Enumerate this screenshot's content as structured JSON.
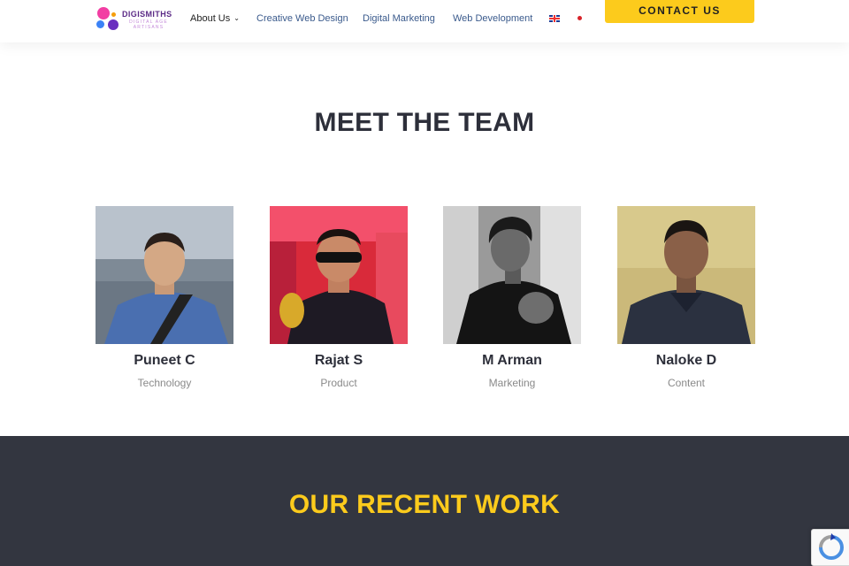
{
  "brand": {
    "name": "DIGISMITHS",
    "tagline": "DIGITAL AGE ARTISANS",
    "colors": {
      "pink": "#f23ea3",
      "purple": "#6a2fbf",
      "blue": "#3b82f6",
      "orange": "#f59e0b"
    }
  },
  "nav": {
    "items": [
      {
        "label": "About Us",
        "has_dropdown": true
      },
      {
        "label": "Creative Web Design"
      },
      {
        "label": "Digital Marketing"
      },
      {
        "label": "Web Development"
      }
    ],
    "languages": [
      "english-flag-icon",
      "japanese-flag-icon"
    ],
    "cta": "CONTACT US"
  },
  "team": {
    "title": "MEET THE TEAM",
    "members": [
      {
        "name": "Puneet C",
        "role": "Technology"
      },
      {
        "name": "Rajat S",
        "role": "Product"
      },
      {
        "name": "M Arman",
        "role": "Marketing"
      },
      {
        "name": "Naloke D",
        "role": "Content"
      }
    ]
  },
  "recent": {
    "title": "OUR RECENT WORK"
  },
  "colors": {
    "accent": "#fccb1c",
    "dark_bg": "#333640",
    "heading": "#2d2f3a",
    "nav_link": "#3a5a8c"
  }
}
